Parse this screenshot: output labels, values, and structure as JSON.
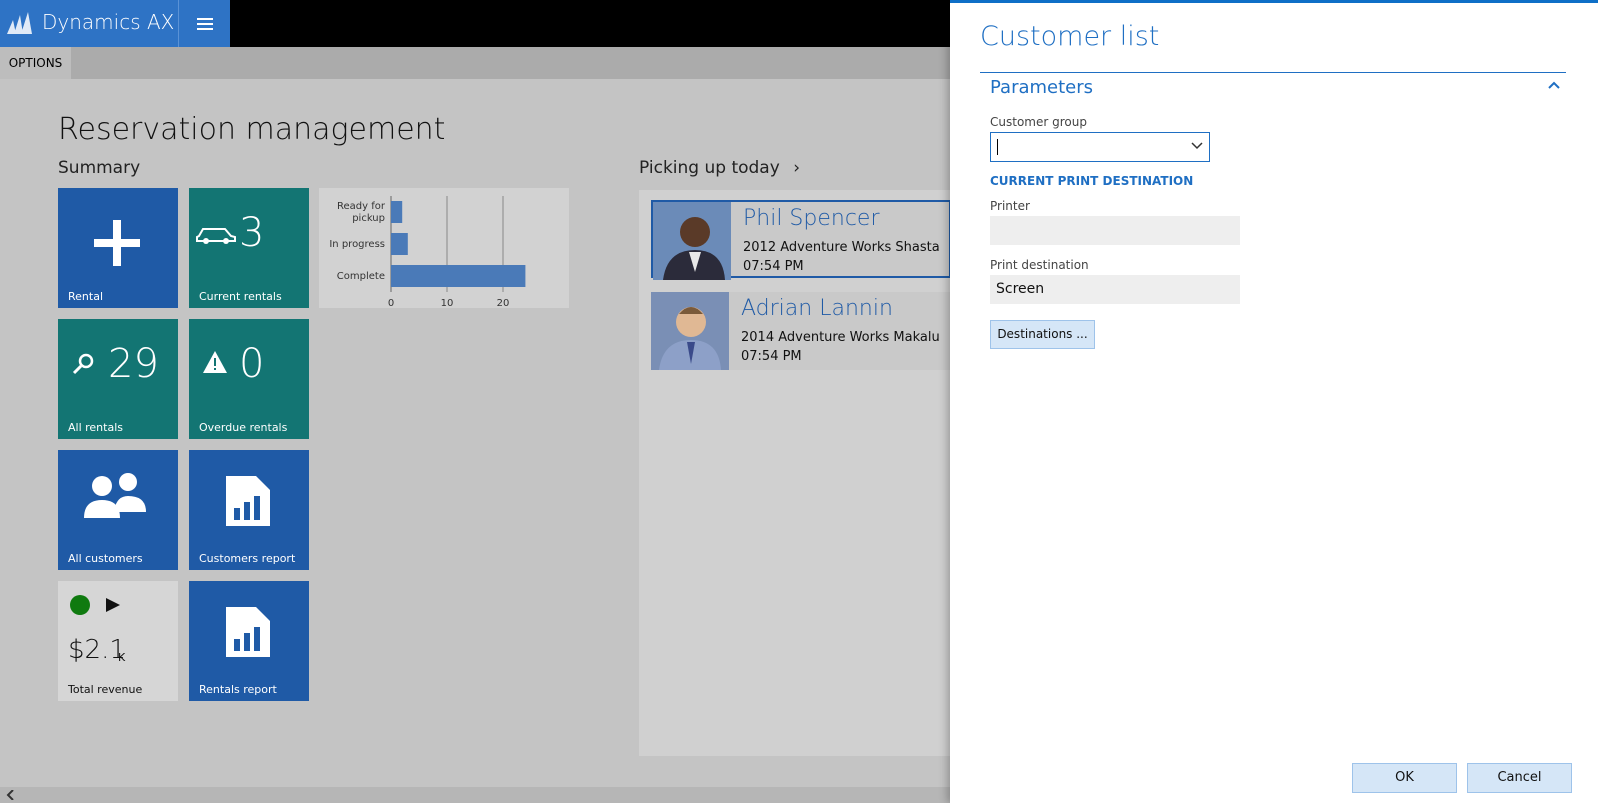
{
  "app": {
    "title": "Dynamics AX"
  },
  "options_label": "OPTIONS",
  "page": {
    "title": "Reservation management"
  },
  "summary": {
    "title": "Summary",
    "tiles": {
      "rental": {
        "label": "Rental"
      },
      "current_rentals": {
        "label": "Current rentals",
        "count": "3"
      },
      "all_rentals": {
        "label": "All rentals",
        "count": "29"
      },
      "overdue_rentals": {
        "label": "Overdue rentals",
        "count": "0"
      },
      "all_customers": {
        "label": "All customers"
      },
      "customers_report": {
        "label": "Customers report"
      },
      "total_revenue": {
        "label": "Total revenue",
        "value": "$2.1",
        "unit": "K"
      },
      "rentals_report": {
        "label": "Rentals report"
      }
    }
  },
  "chart_data": {
    "type": "bar",
    "orientation": "horizontal",
    "categories": [
      "Ready for pickup",
      "In progress",
      "Complete"
    ],
    "category_lines": [
      [
        "Ready for",
        "pickup"
      ],
      [
        "In progress"
      ],
      [
        "Complete"
      ]
    ],
    "values": [
      2,
      3,
      24
    ],
    "xlim": [
      0,
      30
    ],
    "xticks": [
      0,
      10,
      20
    ],
    "grid": true,
    "color": "#4a7ab8"
  },
  "picking": {
    "title": "Picking up today",
    "items": [
      {
        "name": "Phil Spencer",
        "vehicle": "2012 Adventure Works Shasta",
        "time": "07:54 PM"
      },
      {
        "name": "Adrian Lannin",
        "vehicle": "2014 Adventure Works Makalu",
        "time": "07:54 PM"
      }
    ]
  },
  "dialog": {
    "title": "Customer list",
    "section": "Parameters",
    "customer_group": {
      "label": "Customer group",
      "value": ""
    },
    "print_dest_header": "CURRENT PRINT DESTINATION",
    "printer": {
      "label": "Printer",
      "value": ""
    },
    "print_destination": {
      "label": "Print destination",
      "value": "Screen"
    },
    "destinations_button": "Destinations ...",
    "ok": "OK",
    "cancel": "Cancel"
  },
  "colors": {
    "accent": "#1f6fc3",
    "tile_blue": "#1f5aa6",
    "tile_teal": "#137573",
    "status_green": "#0f7a0f"
  }
}
